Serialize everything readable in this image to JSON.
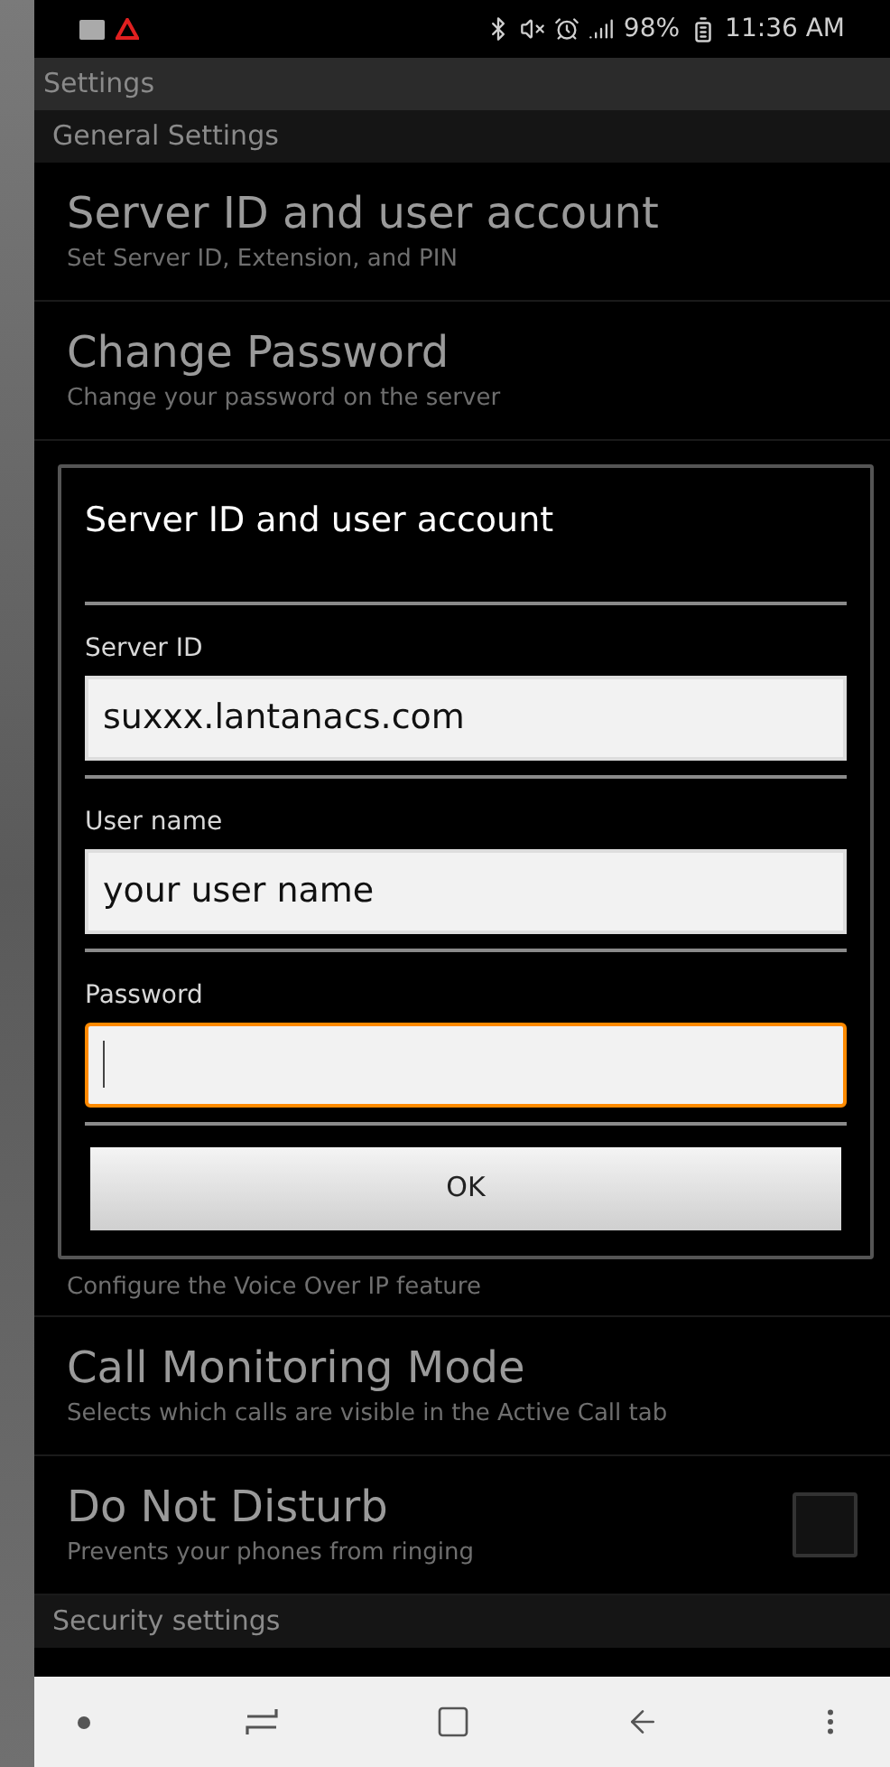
{
  "status_bar": {
    "battery": "98%",
    "time": "11:36 AM"
  },
  "app_bar": {
    "title": "Settings"
  },
  "settings_top": [
    {
      "kind": "header",
      "text": "General Settings"
    },
    {
      "kind": "item",
      "title": "Server ID and user account",
      "subtitle": "Set Server ID, Extension, and PIN"
    },
    {
      "kind": "item",
      "title": "Change Password",
      "subtitle": "Change your password on the server"
    }
  ],
  "settings_bottom": [
    {
      "kind": "item",
      "subtitle": "Configure the Voice Over IP feature"
    },
    {
      "kind": "item",
      "title": "Call Monitoring Mode",
      "subtitle": "Selects which calls are visible in the Active Call tab"
    },
    {
      "kind": "checkbox",
      "title": "Do Not Disturb",
      "subtitle": "Prevents your phones from ringing",
      "checked": false
    },
    {
      "kind": "header",
      "text": "Security settings"
    }
  ],
  "dialog": {
    "title": "Server ID and user account",
    "fields": [
      {
        "label": "Server ID",
        "value": "suxxx.lantanacs.com",
        "focused": false
      },
      {
        "label": "User name",
        "value": "your user name",
        "focused": false
      },
      {
        "label": "Password",
        "focused": true
      }
    ],
    "ok_button": "OK"
  }
}
